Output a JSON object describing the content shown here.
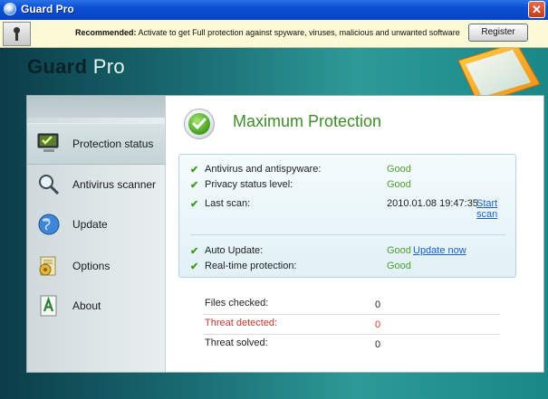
{
  "window": {
    "title": "Guard Pro",
    "close_glyph": "✕"
  },
  "recommendation": {
    "label": "Recommended:",
    "text": "Activate to get Full protection against spyware, viruses, malicious and unwanted software",
    "register_label": "Register"
  },
  "brand": {
    "name": "Guard",
    "suffix": "Pro"
  },
  "sidebar": {
    "items": [
      {
        "label": "Protection status",
        "icon": "monitor-check-icon",
        "active": true
      },
      {
        "label": "Antivirus scanner",
        "icon": "magnifier-icon"
      },
      {
        "label": "Update",
        "icon": "globe-icon"
      },
      {
        "label": "Options",
        "icon": "options-icon"
      },
      {
        "label": "About",
        "icon": "about-icon"
      }
    ]
  },
  "main": {
    "hero_title": "Maximum Protection",
    "status_rows": [
      {
        "label": "Antivirus and antispyware:",
        "value": "Good"
      },
      {
        "label": "Privacy status level:",
        "value": "Good"
      },
      {
        "label": "Last scan:",
        "value": "2010.01.08 19:47:35",
        "link": "Start scan"
      },
      {
        "label": "Auto Update:",
        "value": "Good",
        "link": "Update now"
      },
      {
        "label": "Real-time protection:",
        "value": "Good"
      }
    ],
    "stats": [
      {
        "label": "Files checked:",
        "value": "0"
      },
      {
        "label": "Threat detected:",
        "value": "0"
      },
      {
        "label": "Threat solved:",
        "value": "0"
      }
    ]
  },
  "colors": {
    "accent_green": "#3f8a29",
    "link_blue": "#1b5fc6",
    "threat_red": "#c0392b",
    "titlebar_blue": "#0a4fd3"
  }
}
